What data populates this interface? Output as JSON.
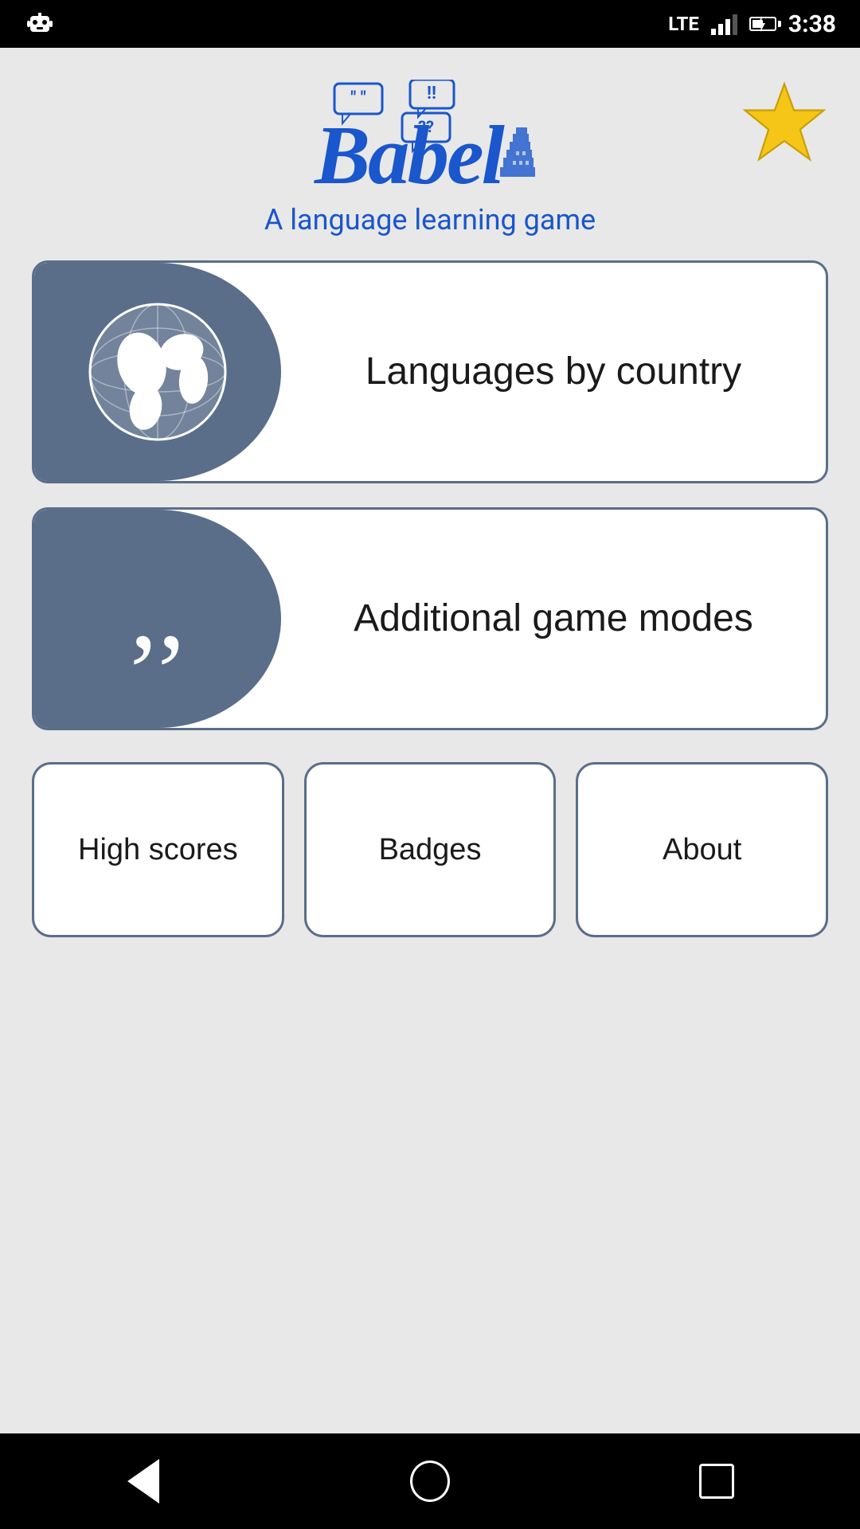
{
  "statusBar": {
    "time": "3:38",
    "signal": "LTE",
    "robotIcon": "🤖"
  },
  "header": {
    "appName": "Babel",
    "subtitle": "A language learning game",
    "starButton": "★"
  },
  "gameModes": [
    {
      "id": "languages-by-country",
      "label": "Languages by\ncountry",
      "icon": "globe"
    },
    {
      "id": "additional-game-modes",
      "label": "Additional game modes",
      "icon": "quotes"
    }
  ],
  "bottomButtons": [
    {
      "id": "high-scores",
      "label": "High scores"
    },
    {
      "id": "badges",
      "label": "Badges"
    },
    {
      "id": "about",
      "label": "About"
    }
  ],
  "colors": {
    "accent": "#5a6e8a",
    "blue": "#1a56cc",
    "star": "#f5c518"
  }
}
